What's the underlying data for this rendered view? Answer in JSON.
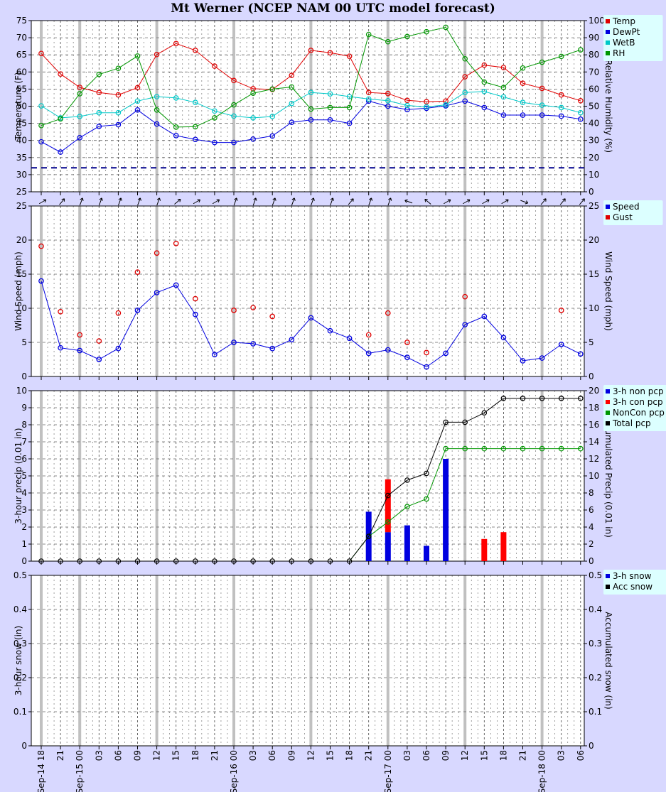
{
  "title": "Mt Werner (NCEP NAM 00 UTC model forecast)",
  "chart_data": [
    {
      "type": "line",
      "panel": "temperature",
      "ylabel": "Temperature (F)",
      "y2label": "Relative Humidity (%)",
      "ylim": [
        25,
        75
      ],
      "y2lim": [
        0,
        100
      ],
      "yticks": [
        25,
        30,
        35,
        40,
        45,
        50,
        55,
        60,
        65,
        70,
        75
      ],
      "y2ticks": [
        0,
        10,
        20,
        30,
        40,
        50,
        60,
        70,
        80,
        90,
        100
      ],
      "freezing_line": 32,
      "freezing_line_color": "#00008b",
      "legend": [
        "Temp",
        "DewPt",
        "WetB",
        "RH"
      ],
      "legend_position": "top-right",
      "series": [
        {
          "name": "Temp",
          "color": "#e00000",
          "axis": "left",
          "values": [
            65.4,
            59.4,
            55.5,
            54,
            53.3,
            55.4,
            65.1,
            68.3,
            66.3,
            61.7,
            57.5,
            55.1,
            54.9,
            59,
            66.3,
            65.6,
            64.6,
            54,
            53.7,
            51.7,
            51.3,
            51.5,
            58.6,
            62,
            61.3,
            56.7,
            55.2,
            53.3,
            51.6
          ]
        },
        {
          "name": "DewPt",
          "color": "#0000e0",
          "axis": "left",
          "values": [
            39.6,
            36.6,
            40.8,
            44.1,
            44.6,
            48.9,
            44.8,
            41.4,
            40.3,
            39.4,
            39.4,
            40.4,
            41.3,
            45.3,
            46,
            46,
            45,
            51.5,
            50,
            49,
            49.4,
            50.1,
            51.5,
            49.6,
            47.4,
            47.4,
            47.4,
            47.1,
            46.2
          ]
        },
        {
          "name": "WetB",
          "color": "#00c8c8",
          "axis": "left",
          "values": [
            50.1,
            46.6,
            47,
            48.1,
            48.1,
            51.5,
            52.8,
            52.4,
            51.1,
            48.6,
            47.1,
            46.6,
            47,
            50.8,
            54,
            53.6,
            52.8,
            52.1,
            51.6,
            50.2,
            49.8,
            50.4,
            54,
            54.3,
            52.7,
            51.1,
            50.3,
            49.6,
            48.1
          ]
        },
        {
          "name": "RH",
          "color": "#009600",
          "axis": "right",
          "values": [
            38.7,
            42.6,
            57.3,
            68.6,
            72.1,
            79.3,
            47.8,
            37.8,
            38,
            43.2,
            50.8,
            57.6,
            60,
            61.2,
            48.3,
            49.2,
            49.2,
            91.9,
            87.7,
            90.7,
            93.5,
            96.1,
            77.7,
            64.1,
            60.9,
            72.3,
            75.7,
            79.1,
            82.9
          ]
        }
      ]
    },
    {
      "type": "scatter",
      "panel": "wind",
      "ylabel": "Wind Speed (mph)",
      "y2label": "Wind Speed (mph)",
      "ylim": [
        0,
        25
      ],
      "yticks": [
        0,
        5,
        10,
        15,
        20,
        25
      ],
      "legend": [
        "Speed",
        "Gust"
      ],
      "legend_position": "top-right",
      "wind_direction_deg": [
        240,
        220,
        200,
        200,
        200,
        200,
        200,
        230,
        240,
        240,
        200,
        200,
        200,
        200,
        200,
        200,
        220,
        200,
        200,
        110,
        130,
        240,
        240,
        240,
        240,
        290,
        220,
        220,
        220
      ],
      "series": [
        {
          "name": "Speed",
          "color": "#0000e0",
          "values": [
            14,
            4.2,
            3.8,
            2.5,
            4.1,
            9.7,
            12.3,
            13.4,
            9.1,
            3.2,
            5,
            4.8,
            4.1,
            5.4,
            8.6,
            6.7,
            5.6,
            3.4,
            3.9,
            2.8,
            1.4,
            3.4,
            7.6,
            8.8,
            5.7,
            2.3,
            2.7,
            4.7,
            3.3
          ]
        },
        {
          "name": "Gust",
          "color": "#e00000",
          "values": [
            19.1,
            9.5,
            6.1,
            5.2,
            9.3,
            15.3,
            18.1,
            19.5,
            11.4,
            null,
            9.7,
            10.1,
            8.8,
            null,
            null,
            null,
            null,
            6.1,
            9.3,
            5,
            3.5,
            null,
            11.7,
            null,
            null,
            null,
            null,
            9.7,
            null
          ]
        }
      ]
    },
    {
      "type": "bar",
      "panel": "precipitation",
      "ylabel": "3-hour precip (0.01 in)",
      "y2label": "Accumulated Precip (0.01 in)",
      "ylim": [
        0,
        10
      ],
      "y2lim": [
        0,
        20
      ],
      "yticks": [
        0,
        1,
        2,
        3,
        4,
        5,
        6,
        7,
        8,
        9,
        10
      ],
      "y2ticks": [
        0,
        2,
        4,
        6,
        8,
        10,
        12,
        14,
        16,
        18,
        20
      ],
      "legend": [
        "3-h non pcp",
        "3-h con pcp",
        "NonCon pcp",
        "Total pcp"
      ],
      "legend_position": "top-right",
      "series": [
        {
          "name": "3-h non pcp",
          "color": "#0000e0",
          "values": [
            0,
            0,
            0,
            0,
            0,
            0,
            0,
            0,
            0,
            0,
            0,
            0,
            0,
            0,
            0,
            0,
            0,
            2.9,
            1.7,
            2.1,
            0.9,
            6,
            0,
            0,
            0,
            0,
            0,
            0,
            0
          ]
        },
        {
          "name": "3-h con pcp",
          "color": "#ff0000",
          "values": [
            0,
            0,
            0,
            0,
            0,
            0,
            0,
            0,
            0,
            0,
            0,
            0,
            0,
            0,
            0,
            0,
            0,
            0,
            3.1,
            0,
            0,
            0,
            0,
            1.3,
            1.7,
            0,
            0,
            0,
            0
          ]
        },
        {
          "name": "NonCon pcp",
          "color": "#009600",
          "axis": "right",
          "values": [
            0,
            0,
            0,
            0,
            0,
            0,
            0,
            0,
            0,
            0,
            0,
            0,
            0,
            0,
            0,
            0,
            0,
            2.9,
            4.6,
            6.4,
            7.3,
            13.2,
            13.2,
            13.2,
            13.2,
            13.2,
            13.2,
            13.2,
            13.2
          ]
        },
        {
          "name": "Total pcp",
          "color": "#000000",
          "axis": "right",
          "values": [
            0,
            0,
            0,
            0,
            0,
            0,
            0,
            0,
            0,
            0,
            0,
            0,
            0,
            0,
            0,
            0,
            0,
            2.9,
            7.7,
            9.5,
            10.3,
            16.3,
            16.3,
            17.4,
            19.1,
            19.1,
            19.1,
            19.1,
            19.1
          ]
        }
      ]
    },
    {
      "type": "bar",
      "panel": "snow",
      "ylabel": "3-hour snow (in)",
      "y2label": "Accumulated snow (in)",
      "ylim": [
        0,
        0.5
      ],
      "yticks": [
        "0",
        "0.1",
        "0.2",
        "0.3",
        "0.4",
        "0.5"
      ],
      "legend": [
        "3-h snow",
        "Acc snow"
      ],
      "legend_position": "top-right",
      "series": [
        {
          "name": "3-h snow",
          "color": "#0000e0",
          "values": [
            0,
            0,
            0,
            0,
            0,
            0,
            0,
            0,
            0,
            0,
            0,
            0,
            0,
            0,
            0,
            0,
            0,
            0,
            0,
            0,
            0,
            0,
            0,
            0,
            0,
            0,
            0,
            0,
            0
          ]
        },
        {
          "name": "Acc snow",
          "color": "#000000",
          "values": [
            0,
            0,
            0,
            0,
            0,
            0,
            0,
            0,
            0,
            0,
            0,
            0,
            0,
            0,
            0,
            0,
            0,
            0,
            0,
            0,
            0,
            0,
            0,
            0,
            0,
            0,
            0,
            0,
            0
          ]
        }
      ]
    }
  ],
  "x_tick_labels": [
    "Sep-14 18",
    "21",
    "Sep-15 00",
    "03",
    "06",
    "09",
    "12",
    "15",
    "18",
    "21",
    "Sep-16 00",
    "03",
    "06",
    "09",
    "12",
    "15",
    "18",
    "21",
    "Sep-17 00",
    "03",
    "06",
    "09",
    "12",
    "15",
    "18",
    "21",
    "Sep-18 00",
    "03",
    "06"
  ]
}
